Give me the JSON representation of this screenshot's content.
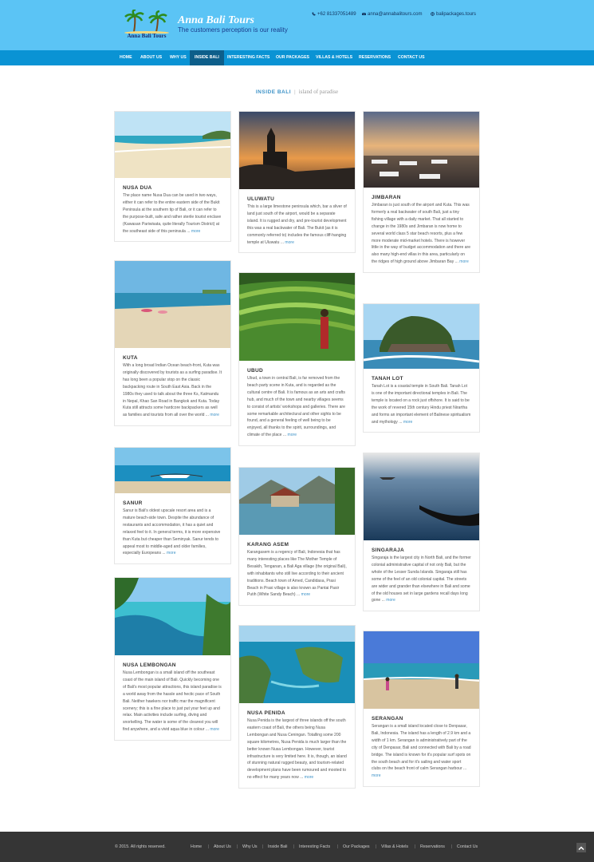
{
  "header": {
    "logo_caption": "Anna Bali Tours",
    "brand_title": "Anna Bali Tours",
    "tagline": "The customers perception is our reality",
    "phone": "+62 81337051489",
    "email": "anna@annabalitours.com",
    "website": "balipackages.tours"
  },
  "nav": [
    "HOME",
    "ABOUT US",
    "WHY US",
    "INSIDE BALI",
    "INTERESTING FACTS",
    "OUR PACKAGES",
    "VILLAS & HOTELS",
    "RESERVATIONS",
    "CONTACT US"
  ],
  "nav_active": "INSIDE BALI",
  "section": {
    "title": "INSIDE BALI",
    "separator": "|",
    "subtitle": "island of paradise"
  },
  "more_label": "more",
  "cards": [
    {
      "title": "NUSA DUA",
      "text": "The place name Nusa Dua can be used in two ways, either it can refer to the entire eastern side of the Bukit Peninsula at the southern tip of Bali, or it can refer to the purpose-built, safe and rather sterile tourist enclave (Kawasan Pariwisata, quite literally Tourism District) at the southeast side of this peninsula ..."
    },
    {
      "title": "KUTA",
      "text": "With a long broad Indian Ocean beach-front, Kuta was originally discovered by tourists as a surfing paradise. It has long been a popular stop on the classic backpacking route in South East Asia. Back in the 1980s they used to talk about the three Ks, Katmandu in Nepal, Khao San Road in Bangkok and Kuta. Today Kuta still attracts some hardcore backpackers as well as families and tourists from all over the world ..."
    },
    {
      "title": "SANUR",
      "text": "Sanur is Bali's oldest upscale resort area and is a mature beach-side town. Despite the abundance of restaurants and accommodation, it has a quiet and relaxed feel to it. In general terms, it is more expensive than Kuta but cheaper than Seminyak. Sanur tends to appeal most to middle-aged and older families, especially Europeans ..."
    },
    {
      "title": "NUSA LEMBONGAN",
      "text": "Nusa Lembongan is a small island off the southeast coast of the main island of Bali. Quickly becoming one of Bali's most popular attractions, this island paradise is a world away from the hassle and hectic pace of South Bali. Neither hawkers nor traffic mar the magnificent scenery; this is a fine place to just put your feet up and relax. Main activities include surfing, diving and snorkelling. The water is some of the clearest you will find anywhere, and a vivid aqua blue in colour ..."
    },
    {
      "title": "ULUWATU",
      "text": "This is a large limestone peninsula which, bar a sliver of land just south of the airport, would be a separate island. It is rugged and dry, and pre-tourist development this was a real backwater of Bali. The Bukit (as it is commonly referred to) includes the famous cliff-hanging temple at Uluwatu ..."
    },
    {
      "title": "UBUD",
      "text": "Ubud, a town in central Bali, is far removed from the beach party scene in Kuta, and is regarded as the cultural centre of Bali. It is famous as an arts and crafts hub, and much of the town and nearby villages seems to consist of artists' workshops and galleries. There are some remarkable architectural and other sights to be found, and a general feeling of well being to be enjoyed, all thanks to the spirit, surroundings, and climate of the place ..."
    },
    {
      "title": "KARANG ASEM",
      "text": "Karangasem is a regency of Bali, Indonesia that has many interesting places like The Mother Temple of Besakih, Tenganan, a Bali Aga village (the original Bali), with inhabitants who still live according to their ancient traditions. Beach town of Amed, Candidasa, Prasi Beach in Prasi village is also known as Pantai Pasir Putih (White Sandy Beach) ..."
    },
    {
      "title": "NUSA PENIDA",
      "text": "Nusa Penida is the largest of three islands off the south eastern coast of Bali, the others being Nusa Lembongan and Nusa Ceningan. Totalling some 200 square kilometres, Nusa Penida is much larger than the better known Nusa Lembongan. However, tourist infrastructure is very limited here. It is, though, an island of stunning natural rugged beauty, and tourism-related development plans have been rumoured and mooted to no effect for many years now ..."
    },
    {
      "title": "JIMBARAN",
      "text": "Jimbaran is just south of the airport and Kuta. This was formerly a real backwater of south Bali, just a tiny fishing village with a daily market. That all started to change in the 1980s and Jimbaran is now home to several world class 5 star beach resorts, plus a few more moderate mid-market hotels. There is however little in the way of budget accommodation and there are also many high-end villas in this area, particularly on the ridges of high ground above Jimbaran Bay ..."
    },
    {
      "title": "TANAH LOT",
      "text": "Tanah Lot is a coastal temple in South Bali. Tanah Lot is one of the important directional temples in Bali. The temple is located on a rock just offshore. It is said to be the work of revered 15th century Hindu priest Nirartha and forms an important element of Balinese spiritualism and mythology ..."
    },
    {
      "title": "SINGARAJA",
      "text": "Singaraja is the largest city in North Bali, and the former colonial administrative capital of not only Bali, but the whole of the Lesser Sunda Islands. Singaraja still has some of the feel of an old colonial capital. The streets are wider and grander than elsewhere in Bali and some of the old houses set in large gardens recall days long gone ..."
    },
    {
      "title": "SERANGAN",
      "text": "Serangan is a small island located close to Denpasar, Bali, Indonesia. The island has a length of 2.9 km and a width of 1 km. Serangan is administratively part of the city of Denpasar, Bali and connected with Bali by a road bridge. The island is known for it's popular surf spots on the south beach and for it's sailing and water sport clubs on the beach front of calm Serangan harbour ..."
    }
  ],
  "footer": {
    "copyright": "© 2015. All rights reserved.",
    "links": [
      "Home",
      "About Us",
      "Why Us",
      "Inside Bali",
      "Interesting Facts",
      "Our Packages",
      "Villas & Hotels",
      "Reservations",
      "Contact Us"
    ],
    "separator": "|"
  }
}
